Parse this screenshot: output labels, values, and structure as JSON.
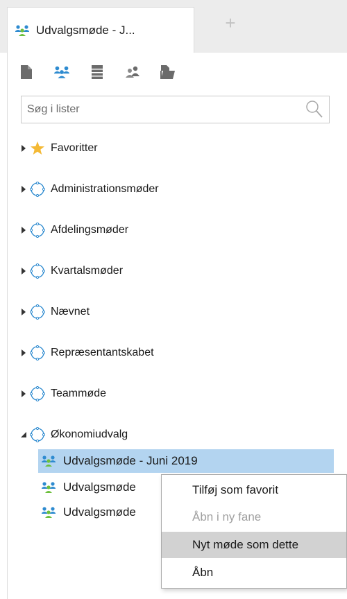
{
  "tabs": [
    {
      "label": "Udvalgsmøde - J...",
      "icon": "meeting-group-icon",
      "active": true
    }
  ],
  "new_tab_glyph": "+",
  "toolbar": {
    "buttons": [
      {
        "name": "document-icon"
      },
      {
        "name": "meeting-group-icon"
      },
      {
        "name": "list-icon"
      },
      {
        "name": "people-icon"
      },
      {
        "name": "open-folder-icon"
      }
    ]
  },
  "search": {
    "placeholder": "Søg i lister",
    "value": ""
  },
  "tree": {
    "nodes": [
      {
        "label": "Favoritter",
        "icon": "star-icon",
        "expanded": false
      },
      {
        "label": "Administrationsmøder",
        "icon": "circle-dashed-icon",
        "expanded": false
      },
      {
        "label": "Afdelingsmøder",
        "icon": "circle-dashed-icon",
        "expanded": false
      },
      {
        "label": "Kvartalsmøder",
        "icon": "circle-dashed-icon",
        "expanded": false
      },
      {
        "label": "Nævnet",
        "icon": "circle-dashed-icon",
        "expanded": false
      },
      {
        "label": "Repræsentantskabet",
        "icon": "circle-dashed-icon",
        "expanded": false
      },
      {
        "label": "Teammøde",
        "icon": "circle-dashed-icon",
        "expanded": false
      },
      {
        "label": "Økonomiudvalg",
        "icon": "circle-dashed-icon",
        "expanded": true
      }
    ],
    "children": [
      {
        "label": "Udvalgsmøde - Juni 2019",
        "selected": true
      },
      {
        "label": "Udvalgsmøde",
        "selected": false
      },
      {
        "label": "Udvalgsmøde",
        "selected": false
      }
    ]
  },
  "context_menu": {
    "items": [
      {
        "label": "Tilføj som favorit",
        "enabled": true
      },
      {
        "label": "Åbn i ny fane",
        "enabled": false
      },
      {
        "label": "Nyt møde som dette",
        "enabled": true,
        "hover": true
      },
      {
        "label": "Åbn",
        "enabled": true
      }
    ]
  },
  "colors": {
    "selection": "#b3d4f0",
    "menu_hover": "#d2d2d2",
    "star": "#f4b935",
    "icon_blue": "#2e8bd0",
    "icon_green": "#6cbf3c",
    "icon_gray": "#6b6b6b"
  }
}
